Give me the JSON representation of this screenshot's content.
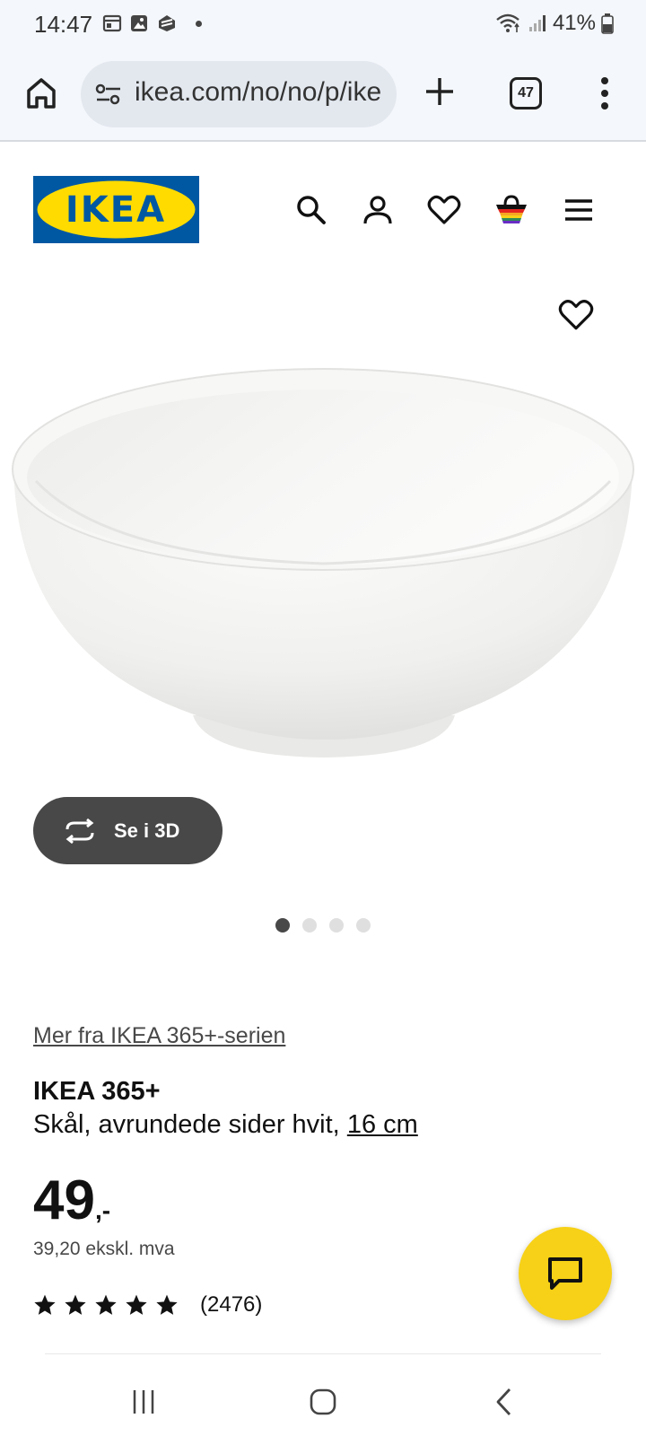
{
  "status_bar": {
    "time": "14:47",
    "battery": "41%"
  },
  "browser": {
    "url": "ikea.com/no/no/p/ike",
    "tab_count": "47"
  },
  "header": {
    "logo_text": "IKEA",
    "icons": [
      "search-icon",
      "user-icon",
      "heart-icon",
      "cart-icon",
      "menu-icon"
    ]
  },
  "gallery": {
    "view_3d_label": "Se i 3D",
    "image_count": 4,
    "active_index": 0
  },
  "product": {
    "series_link": "Mer fra IKEA 365+-serien",
    "name": "IKEA 365+",
    "description": "Skål, avrundede sider hvit, ",
    "size": "16 cm",
    "price_integer": "49",
    "price_suffix": ",-",
    "price_ex_vat": "39,20 ekskl. mva",
    "rating_stars": 5,
    "rating_count": "(2476)"
  },
  "colors": {
    "ikea_blue": "#0058a3",
    "ikea_yellow": "#ffdb00",
    "chat_yellow": "#f7d117",
    "dark_gray": "#484848"
  }
}
